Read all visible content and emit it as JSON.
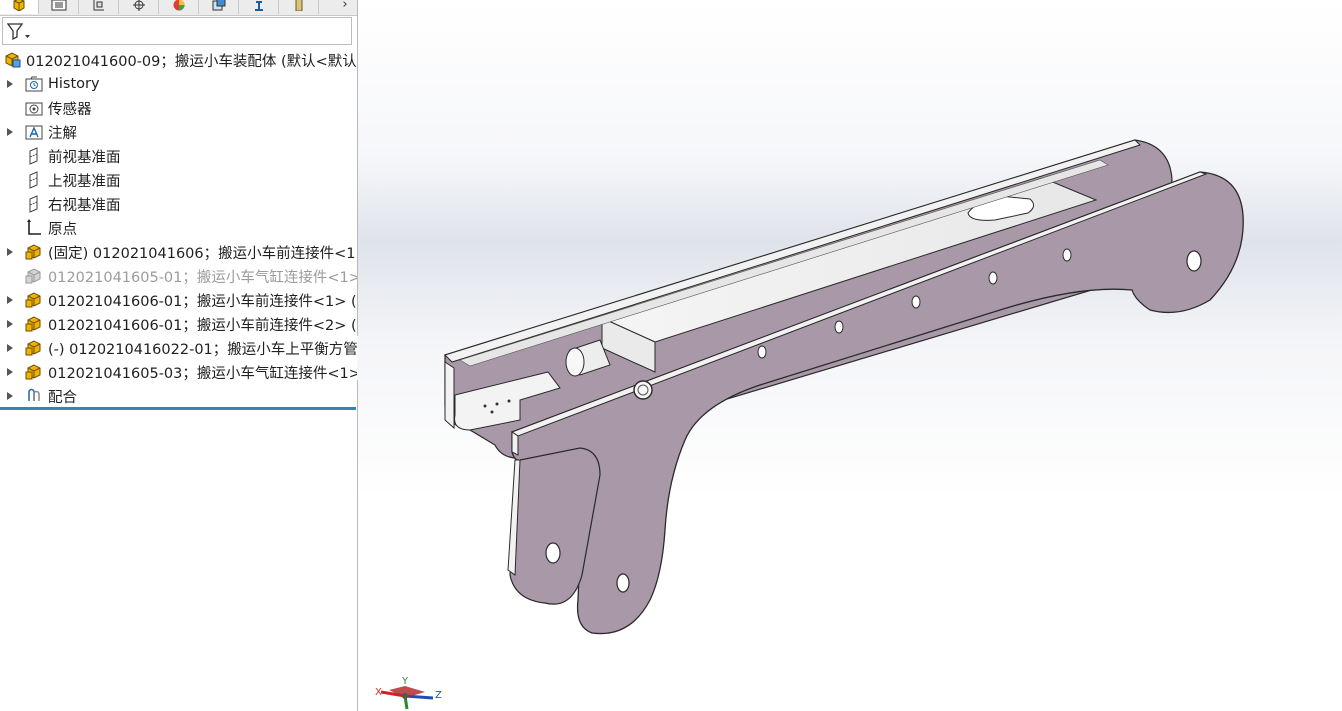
{
  "feature_manager": {
    "tabs": [
      {
        "icon": "feature-tree-icon",
        "active": true
      },
      {
        "icon": "property-manager-icon"
      },
      {
        "icon": "configuration-manager-icon"
      },
      {
        "icon": "dimxpert-icon"
      },
      {
        "icon": "display-manager-icon"
      },
      {
        "icon": "cam-icon"
      },
      {
        "icon": "simulation-icon"
      },
      {
        "icon": "misc-icon"
      }
    ],
    "more_label": "›",
    "root": {
      "label": "012021041600-09；搬运小车装配体  (默认<默认",
      "icon": "assembly-icon"
    },
    "items": [
      {
        "label": "History",
        "icon": "history-folder-icon",
        "expandable": true
      },
      {
        "label": "传感器",
        "icon": "sensor-folder-icon",
        "expandable": false
      },
      {
        "label": "注解",
        "icon": "annotations-icon",
        "expandable": true
      },
      {
        "label": "前视基准面",
        "icon": "plane-icon",
        "expandable": false
      },
      {
        "label": "上视基准面",
        "icon": "plane-icon",
        "expandable": false
      },
      {
        "label": "右视基准面",
        "icon": "plane-icon",
        "expandable": false
      },
      {
        "label": "原点",
        "icon": "origin-icon",
        "expandable": false
      },
      {
        "label": "(固定) 012021041606；搬运小车前连接件<1",
        "icon": "part-icon",
        "expandable": true
      },
      {
        "label": "012021041605-01；搬运小车气缸连接件<1>",
        "icon": "part-suppressed-icon",
        "expandable": false,
        "suppressed": true
      },
      {
        "label": "012021041606-01；搬运小车前连接件<1> (",
        "icon": "part-icon",
        "expandable": true
      },
      {
        "label": "012021041606-01；搬运小车前连接件<2> (",
        "icon": "part-icon",
        "expandable": true
      },
      {
        "label": "(-) 0120210416022-01；搬运小车上平衡方管",
        "icon": "part-icon",
        "expandable": true
      },
      {
        "label": "012021041605-03；搬运小车气缸连接件<1>",
        "icon": "part-icon",
        "expandable": true
      },
      {
        "label": "配合",
        "icon": "mates-icon",
        "expandable": true
      }
    ]
  },
  "viewport": {
    "triad": {
      "x_label": "X",
      "y_label": "Y",
      "z_label": "Z"
    }
  },
  "colors": {
    "part_body": "#a898a8",
    "part_edge": "#2a2a2a",
    "part_face_light": "#f2f2f2",
    "selection_bar": "#2e86c1",
    "icon_yellow": "#f0b400"
  }
}
